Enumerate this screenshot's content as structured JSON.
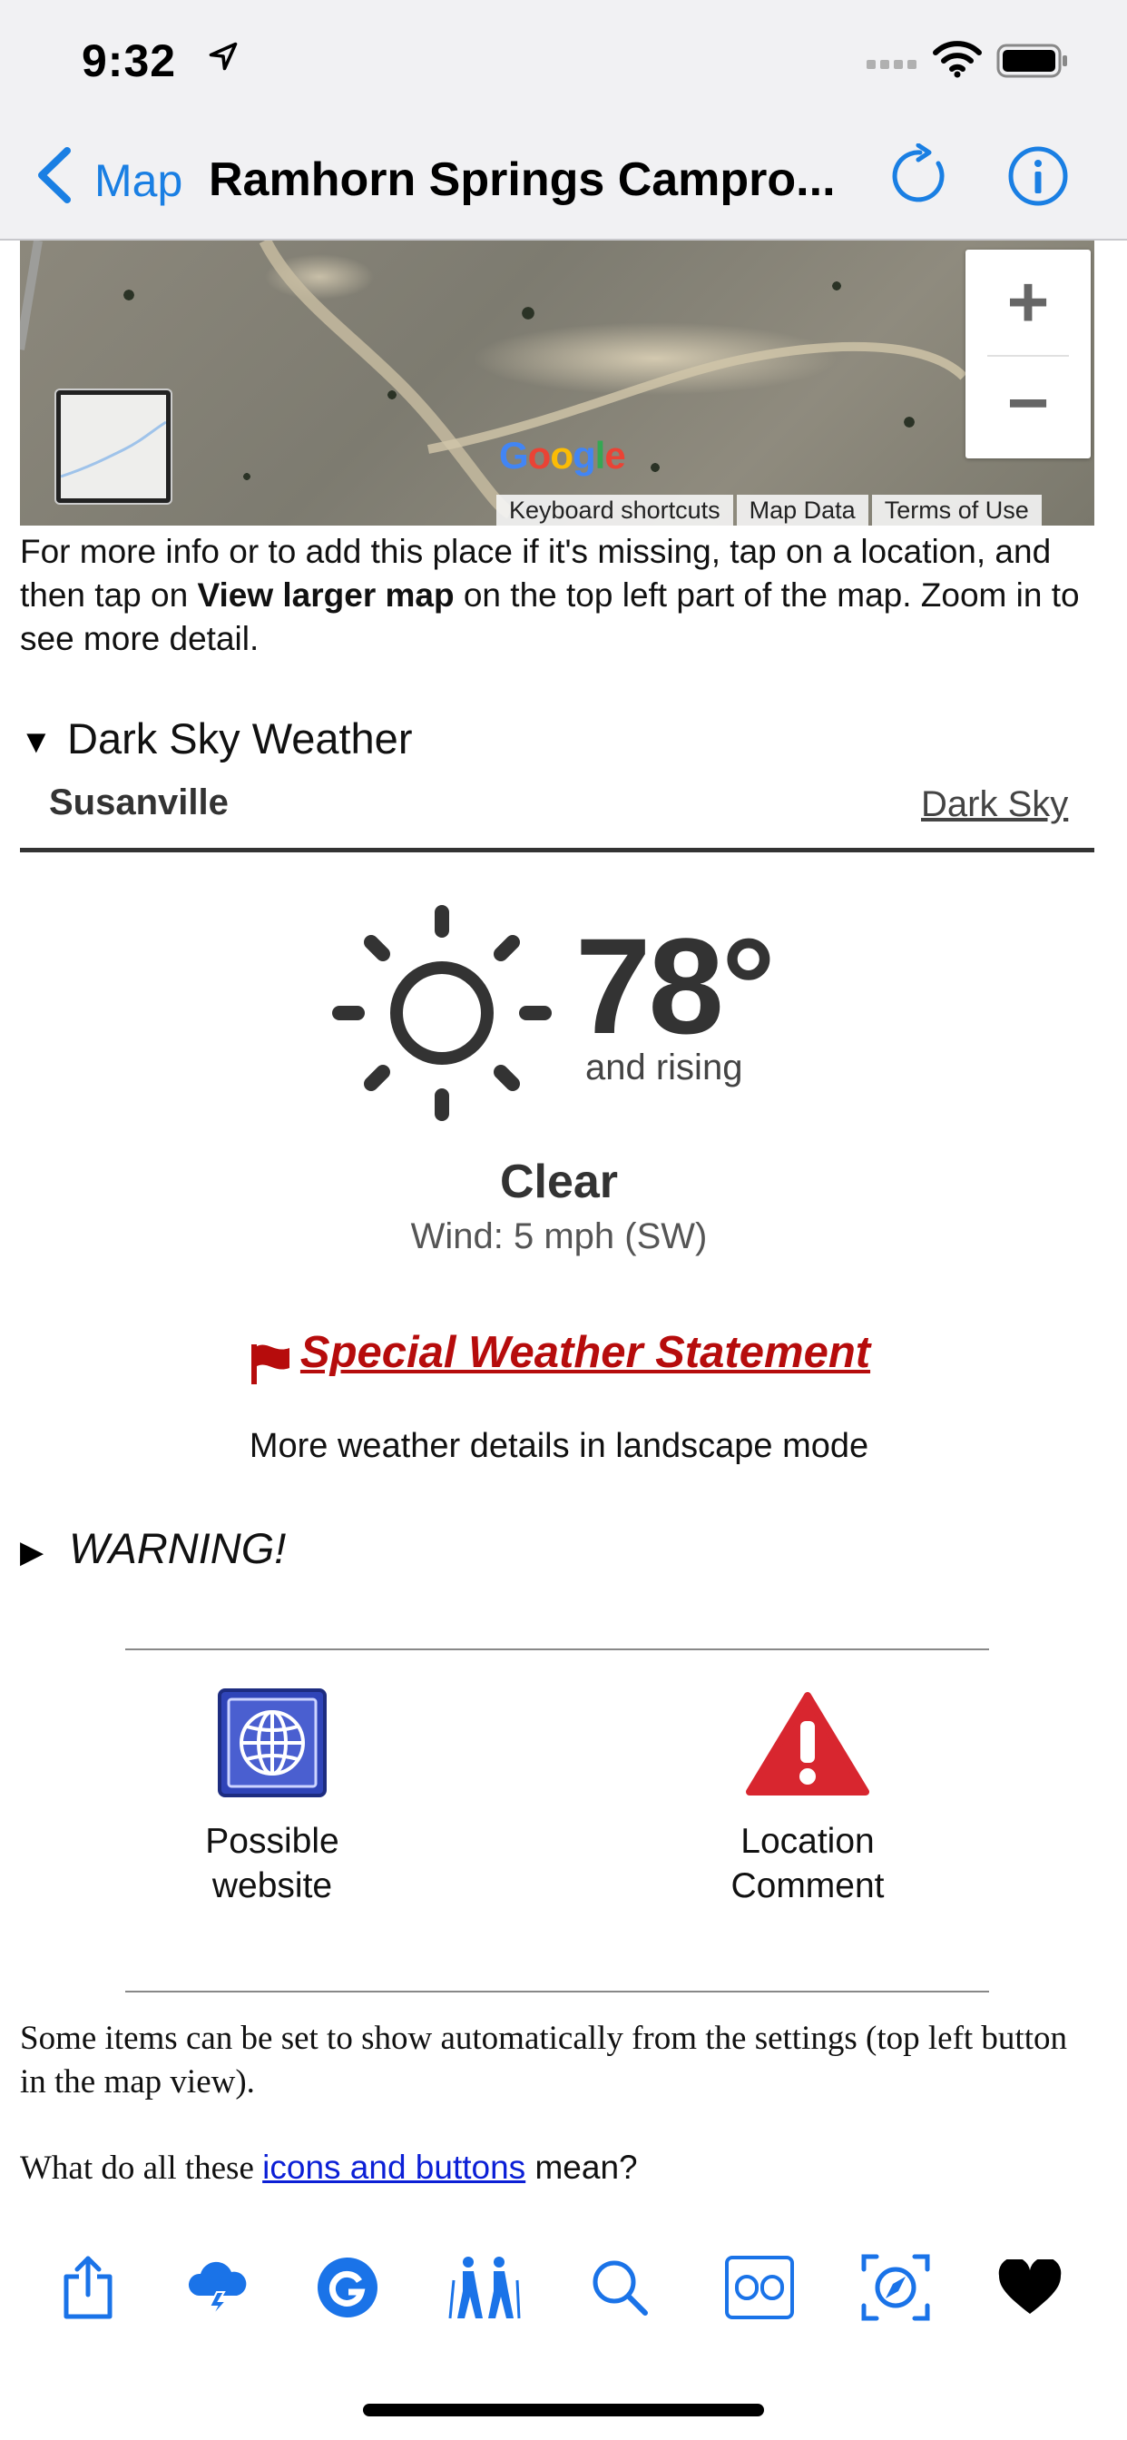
{
  "status_bar": {
    "time": "9:32"
  },
  "nav": {
    "back_label": "Map",
    "title": "Ramhorn Springs  Campro..."
  },
  "map": {
    "logo": "Google",
    "footer": [
      "Keyboard shortcuts",
      "Map Data",
      "Terms of Use"
    ],
    "zoom_in": "+",
    "zoom_out": "−"
  },
  "map_note": {
    "part1": "For more info or to add this place if it's missing, tap on a location, and then tap on ",
    "bold": "View larger map",
    "part2": " on the top left part of the map. Zoom in to see more detail."
  },
  "dark_sky": {
    "toggle": "▼",
    "title": "Dark Sky Weather",
    "location": "Susanville",
    "link": "Dark Sky",
    "temperature": "78°",
    "trend": "and rising",
    "condition": "Clear",
    "wind": "Wind: 5 mph (SW)",
    "alert": "Special Weather Statement",
    "landscape_note": "More weather details in landscape mode"
  },
  "warning": {
    "toggle": "▶",
    "title": "WARNING!"
  },
  "actions": [
    {
      "label_line1": "Possible",
      "label_line2": "website",
      "icon": "globe-icon"
    },
    {
      "label_line1": "Location",
      "label_line2": "Comment",
      "icon": "warning-triangle-icon"
    }
  ],
  "footer_text": {
    "settings_note": "Some items can be set to show automatically from the settings (top left button in the map view).",
    "question_prefix": "What do all these ",
    "question_link": "icons and buttons",
    "question_suffix": " mean?"
  },
  "toolbar": [
    "share-icon",
    "weather-icon",
    "google-icon",
    "hikers-icon",
    "search-icon",
    "streetview-icon",
    "compass-icon",
    "heart-icon"
  ],
  "colors": {
    "accent": "#1a7fe3",
    "alert": "#b60c0c",
    "link": "#0b1fd6",
    "toolbar": "#1a73e8"
  }
}
